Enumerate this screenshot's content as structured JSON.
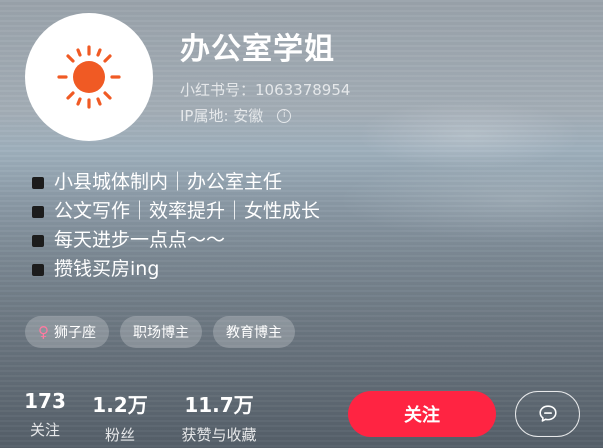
{
  "profile": {
    "name": "办公室学姐",
    "id_line": "小红书号：1063378954",
    "ip_line": "IP属地: 安徽",
    "avatar_icon": "sun-icon",
    "avatar_color": "#f05a24"
  },
  "bio": [
    "小县城体制内｜办公室主任",
    "公文写作｜效率提升｜女性成长",
    "每天进步一点点～～",
    "攒钱买房ing"
  ],
  "tags": [
    {
      "label": "狮子座",
      "icon": "female-icon"
    },
    {
      "label": "职场博主"
    },
    {
      "label": "教育博主"
    }
  ],
  "stats": [
    {
      "value": "173",
      "label": "关注"
    },
    {
      "value": "1.2万",
      "label": "粉丝"
    },
    {
      "value": "11.7万",
      "label": "获赞与收藏"
    }
  ],
  "actions": {
    "follow_label": "关注",
    "follow_color": "#ff2442",
    "chat_icon": "chat-bubble-icon"
  }
}
